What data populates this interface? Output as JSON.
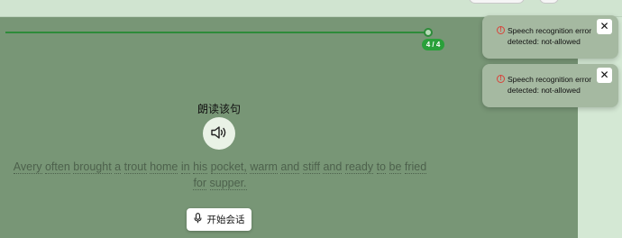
{
  "progress": {
    "badge": "4 / 4",
    "current": 4,
    "total": 4
  },
  "exercise": {
    "heading": "朗读该句",
    "sentence_words": [
      "Avery",
      "often",
      "brought",
      "a",
      "trout",
      "home",
      "in",
      "his",
      "pocket,",
      "warm",
      "and",
      "stiff",
      "and",
      "ready",
      "to",
      "be",
      "fried",
      "for",
      "supper."
    ],
    "start_button_label": "开始会话",
    "icons": {
      "speaker": "speaker-icon",
      "microphone": "microphone-icon"
    }
  },
  "toasts": [
    {
      "line1": "Speech recognition error",
      "line2": "detected: not-allowed",
      "close": "✕",
      "icon": "error-icon"
    },
    {
      "line1": "Speech recognition error",
      "line2": "detected: not-allowed",
      "close": "✕",
      "icon": "error-icon"
    }
  ],
  "colors": {
    "accent": "#2e8b3a",
    "overlay": "#789676",
    "error": "#d9433a"
  }
}
